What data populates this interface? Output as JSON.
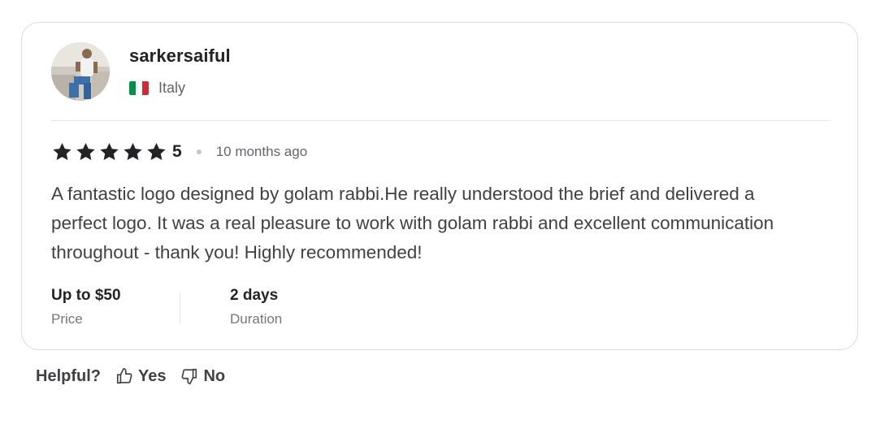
{
  "reviewer": {
    "username": "sarkersaiful",
    "country": "Italy",
    "flag_colors": [
      "#009246",
      "#ffffff",
      "#ce2b37"
    ]
  },
  "rating": {
    "stars": 5,
    "score": "5",
    "time_ago": "10 months ago",
    "star_color": "#222325"
  },
  "review": {
    "text": "A fantastic logo designed by golam rabbi.He really understood the brief and delivered a perfect logo. It was a real pleasure to work with golam rabbi and excellent communication throughout - thank you! Highly recommended!"
  },
  "details": {
    "price_value": "Up to $50",
    "price_label": "Price",
    "duration_value": "2 days",
    "duration_label": "Duration"
  },
  "helpful": {
    "label": "Helpful?",
    "yes_label": "Yes",
    "no_label": "No",
    "yes_icon": "thumbs-up-icon",
    "no_icon": "thumbs-down-icon"
  }
}
